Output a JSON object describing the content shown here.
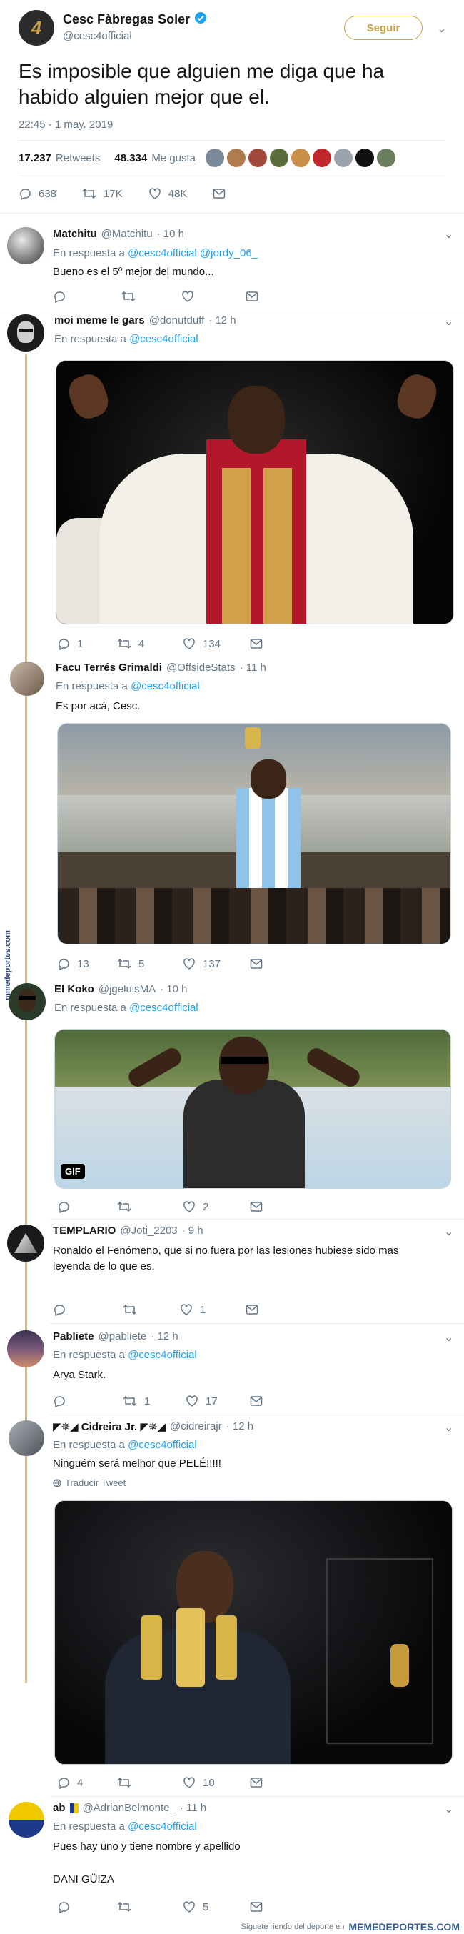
{
  "main_tweet": {
    "author_name": "Cesc Fàbregas Soler",
    "author_handle": "@cesc4official",
    "avatar_text": "4",
    "follow_label": "Seguir",
    "text": "Es imposible que alguien me diga que ha habido alguien mejor que el.",
    "timestamp": "22:45 - 1 may. 2019",
    "retweets_count": "17.237",
    "retweets_label": "Retweets",
    "likes_count": "48.334",
    "likes_label": "Me gusta",
    "reply_count": "638",
    "retweet_count": "17K",
    "like_count": "48K"
  },
  "replies": [
    {
      "name": "Matchitu",
      "handle": "@Matchitu",
      "time": "· 10 h",
      "reply_prefix": "En respuesta a",
      "reply_to": "@cesc4official @jordy_06_",
      "text": "Bueno es el 5º mejor del mundo...",
      "replies": "",
      "retweets": "",
      "likes": ""
    },
    {
      "name": "moi meme le gars",
      "handle": "@donutduff",
      "time": "· 12 h",
      "reply_prefix": "En respuesta a",
      "reply_to": "@cesc4official",
      "text": "",
      "replies": "1",
      "retweets": "4",
      "likes": "134"
    },
    {
      "name": "Facu Terrés Grimaldi",
      "handle": "@OffsideStats",
      "time": "· 11 h",
      "reply_prefix": "En respuesta a",
      "reply_to": "@cesc4official",
      "text": "Es por acá, Cesc.",
      "replies": "13",
      "retweets": "5",
      "likes": "137"
    },
    {
      "name": "El Koko",
      "handle": "@jgeluisMA",
      "time": "· 10 h",
      "reply_prefix": "En respuesta a",
      "reply_to": "@cesc4official",
      "text": "",
      "replies": "",
      "retweets": "",
      "likes": "2",
      "gif_label": "GIF"
    },
    {
      "name": "TEMPLARIO",
      "handle": "@Joti_2203",
      "time": "· 9 h",
      "reply_prefix": "",
      "reply_to": "",
      "text": "Ronaldo el Fenómeno, que si no fuera por las lesiones hubiese sido mas leyenda de lo que es.",
      "replies": "",
      "retweets": "",
      "likes": "1"
    },
    {
      "name": "Pabliete",
      "handle": "@pabliete",
      "time": "· 12 h",
      "reply_prefix": "En respuesta a",
      "reply_to": "@cesc4official",
      "text": "Arya Stark.",
      "replies": "",
      "retweets": "1",
      "likes": "17"
    },
    {
      "name": "◤✵◢ Cidreira Jr. ◤✵◢",
      "handle": "@cidreirajr",
      "time": "· 12 h",
      "reply_prefix": "En respuesta a",
      "reply_to": "@cesc4official",
      "text": "Ninguém será melhor que PELÉ!!!!!",
      "translate": "Traducir Tweet",
      "replies": "4",
      "retweets": "",
      "likes": "10"
    },
    {
      "name": "ab",
      "handle": "@AdrianBelmonte_",
      "time": "· 11 h",
      "reply_prefix": "En respuesta a",
      "reply_to": "@cesc4official",
      "text": "Pues hay uno y tiene nombre y apellido",
      "text2": "DANI GÜIZA",
      "replies": "",
      "retweets": "",
      "likes": "5"
    }
  ],
  "watermark": {
    "side": "mmedeportes.com",
    "footer_small": "Síguete riendo del deporte en",
    "footer_brand": "MEMEDEPORTES.COM"
  },
  "colors": {
    "accent": "#1da1f2",
    "muted": "#657786",
    "thread": "#e1b97a"
  }
}
